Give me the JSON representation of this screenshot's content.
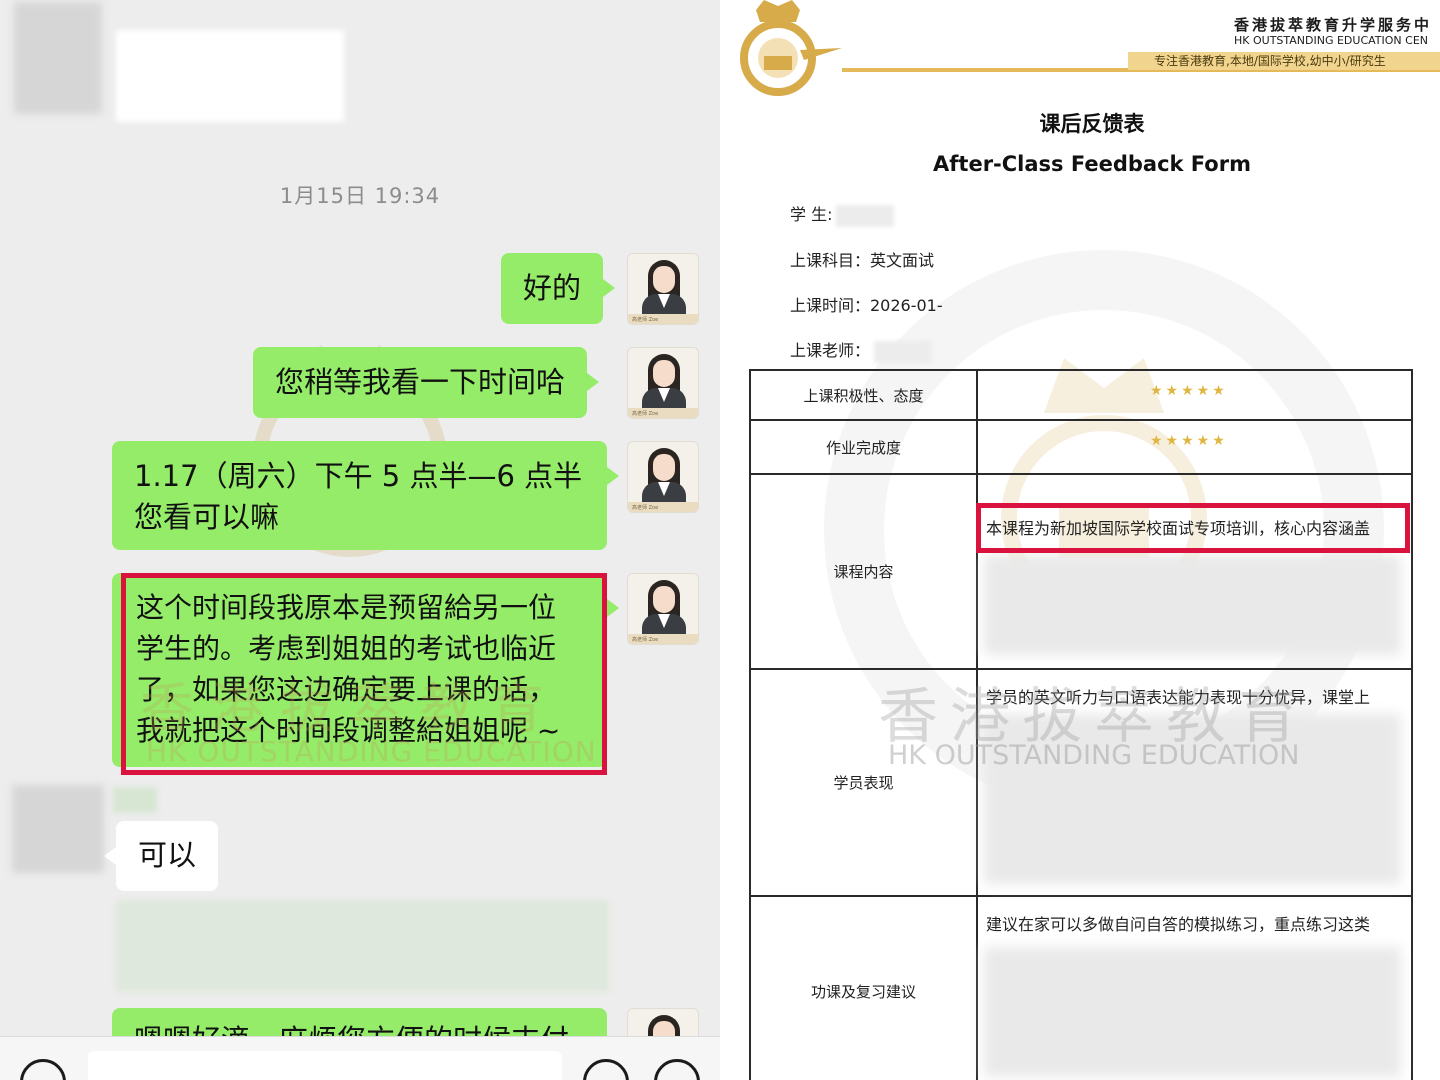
{
  "chat": {
    "timestamp": "1月15日 19:34",
    "messages": [
      {
        "text": "好的"
      },
      {
        "text": "您稍等我看一下时间哈"
      },
      {
        "line1": "1.17（周六）下午 5 点半—6 点半",
        "line2": "您看可以嘛"
      },
      {
        "line1": "这个时间段我原本是预留給另一位",
        "line2": "学生的。考虑到姐姐的考试也临近",
        "line3": "了，如果您这边确定要上课的话，",
        "line4": "我就把这个时间段调整給姐姐呢 ~"
      },
      {
        "text": "可以"
      },
      {
        "text": "嗯嗯好滴，麻烦您方便的时候支付"
      }
    ],
    "avatar_caption": "高老师 Zoe",
    "watermark_cn": "香港拔萃教育",
    "watermark_en": "HK OUTSTANDING EDUCATION",
    "icons": {
      "voice": "voice-icon",
      "emoji": "emoji-icon",
      "add": "add-icon"
    },
    "colors": {
      "sent_bubble": "#95ec69",
      "background": "#ededed",
      "highlight": "#d9133d"
    }
  },
  "form": {
    "org_name_cn": "香港拔萃教育升学服务中",
    "org_name_en": "HK OUTSTANDING EDUCATION CEN",
    "org_tagline": "专注香港教育,本地/国际学校,幼中小/研究生",
    "title_cn": "课后反馈表",
    "title_en": "After-Class Feedback Form",
    "student_label": "学 生:",
    "subject_label": "上课科目：英文面试",
    "time_label": "上课时间：2026-01-",
    "teacher_label": "上课老师：",
    "rows": [
      {
        "label": "上课积极性、态度",
        "stars": "★★★★★"
      },
      {
        "label": "作业完成度",
        "stars": "★★★★★"
      },
      {
        "label": "课程内容",
        "text": "本课程为新加坡国际学校面试专项培训，核心内容涵盖"
      },
      {
        "label": "学员表现",
        "text": "学员的英文听力与口语表达能力表现十分优异，课堂上"
      },
      {
        "label": "功课及复习建议",
        "text": "建议在家可以多做自问自答的模拟练习，重点练习这类"
      }
    ],
    "watermark_cn": "香港拔萃教育",
    "watermark_en": "HK OUTSTANDING EDUCATION",
    "colors": {
      "gold": "#e3b95a",
      "stars": "#e0b642",
      "highlight": "#d9133d"
    }
  }
}
